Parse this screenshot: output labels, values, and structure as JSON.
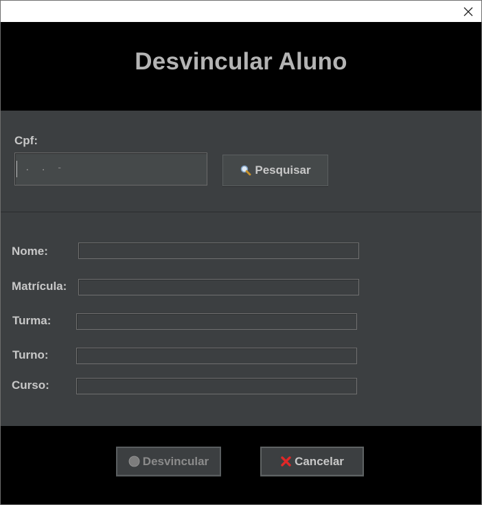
{
  "window": {
    "close_icon": "close-icon"
  },
  "header": {
    "title": "Desvincular Aluno"
  },
  "search": {
    "cpf_label": "Cpf:",
    "cpf_value": " .  .  -",
    "search_button_label": "Pesquisar",
    "search_icon": "magnifier-icon"
  },
  "form": {
    "fields": [
      {
        "label": "Nome:",
        "value": ""
      },
      {
        "label": "Matrícula:",
        "value": ""
      },
      {
        "label": "Turma:",
        "value": ""
      },
      {
        "label": "Turno:",
        "value": ""
      },
      {
        "label": "Curso:",
        "value": ""
      }
    ]
  },
  "footer": {
    "unlink_button_label": "Desvincular",
    "unlink_icon": "disabled-circle-icon",
    "cancel_button_label": "Cancelar",
    "cancel_icon": "red-x-icon"
  },
  "colors": {
    "panel_bg": "#3c3f41",
    "header_bg": "#000000",
    "text": "#c8c8c8",
    "cancel_icon": "#e02828"
  }
}
